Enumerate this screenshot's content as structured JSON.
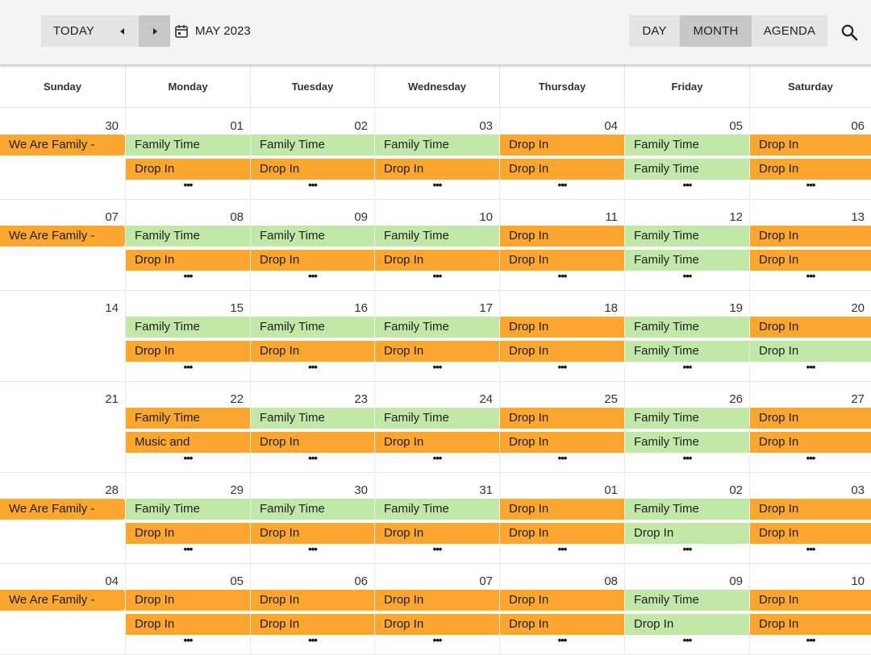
{
  "toolbar": {
    "today_label": "TODAY",
    "prev_icon": "triangle-left",
    "next_icon": "triangle-right",
    "calendar_icon": "calendar-icon",
    "date_range": "MAY 2023",
    "views": [
      {
        "label": "DAY",
        "active": false
      },
      {
        "label": "MONTH",
        "active": true
      },
      {
        "label": "AGENDA",
        "active": false
      }
    ],
    "search_icon": "search-icon"
  },
  "day_names": [
    "Sunday",
    "Monday",
    "Tuesday",
    "Wednesday",
    "Thursday",
    "Friday",
    "Saturday"
  ],
  "colors": {
    "orange": "#fba62f",
    "green": "#c2e8a8"
  },
  "weeks": [
    {
      "days": [
        {
          "date": "30",
          "events": [
            {
              "title": "We Are Family -",
              "color": "orange"
            }
          ]
        },
        {
          "date": "01",
          "events": [
            {
              "title": "Family Time",
              "color": "green"
            },
            {
              "title": "Drop In",
              "color": "orange"
            }
          ],
          "more": "•••"
        },
        {
          "date": "02",
          "events": [
            {
              "title": "Family Time",
              "color": "green"
            },
            {
              "title": "Drop In",
              "color": "orange"
            }
          ],
          "more": "•••"
        },
        {
          "date": "03",
          "events": [
            {
              "title": "Family Time",
              "color": "green"
            },
            {
              "title": "Drop In",
              "color": "orange"
            }
          ],
          "more": "•••"
        },
        {
          "date": "04",
          "events": [
            {
              "title": "Drop In",
              "color": "orange"
            },
            {
              "title": "Drop In",
              "color": "orange"
            }
          ],
          "more": "•••"
        },
        {
          "date": "05",
          "events": [
            {
              "title": "Family Time",
              "color": "green"
            },
            {
              "title": "Family Time",
              "color": "green"
            }
          ],
          "more": "•••"
        },
        {
          "date": "06",
          "events": [
            {
              "title": "Drop In",
              "color": "orange"
            },
            {
              "title": "Drop In",
              "color": "orange"
            }
          ],
          "more": "•••"
        }
      ]
    },
    {
      "days": [
        {
          "date": "07",
          "events": [
            {
              "title": "We Are Family -",
              "color": "orange"
            }
          ]
        },
        {
          "date": "08",
          "events": [
            {
              "title": "Family Time",
              "color": "green"
            },
            {
              "title": "Drop In",
              "color": "orange"
            }
          ],
          "more": "•••"
        },
        {
          "date": "09",
          "events": [
            {
              "title": "Family Time",
              "color": "green"
            },
            {
              "title": "Drop In",
              "color": "orange"
            }
          ],
          "more": "•••"
        },
        {
          "date": "10",
          "events": [
            {
              "title": "Family Time",
              "color": "green"
            },
            {
              "title": "Drop In",
              "color": "orange"
            }
          ],
          "more": "•••"
        },
        {
          "date": "11",
          "events": [
            {
              "title": "Drop In",
              "color": "orange"
            },
            {
              "title": "Drop In",
              "color": "orange"
            }
          ],
          "more": "•••"
        },
        {
          "date": "12",
          "events": [
            {
              "title": "Family Time",
              "color": "green"
            },
            {
              "title": "Family Time",
              "color": "green"
            }
          ],
          "more": "•••"
        },
        {
          "date": "13",
          "events": [
            {
              "title": "Drop In",
              "color": "orange"
            },
            {
              "title": "Drop In",
              "color": "orange"
            }
          ],
          "more": "•••"
        }
      ]
    },
    {
      "days": [
        {
          "date": "14",
          "events": []
        },
        {
          "date": "15",
          "events": [
            {
              "title": "Family Time",
              "color": "green"
            },
            {
              "title": "Drop In",
              "color": "orange"
            }
          ],
          "more": "•••"
        },
        {
          "date": "16",
          "events": [
            {
              "title": "Family Time",
              "color": "green"
            },
            {
              "title": "Drop In",
              "color": "orange"
            }
          ],
          "more": "•••"
        },
        {
          "date": "17",
          "events": [
            {
              "title": "Family Time",
              "color": "green"
            },
            {
              "title": "Drop In",
              "color": "orange"
            }
          ],
          "more": "•••"
        },
        {
          "date": "18",
          "events": [
            {
              "title": "Drop In",
              "color": "orange"
            },
            {
              "title": "Drop In",
              "color": "orange"
            }
          ],
          "more": "•••"
        },
        {
          "date": "19",
          "events": [
            {
              "title": "Family Time",
              "color": "green"
            },
            {
              "title": "Family Time",
              "color": "green"
            }
          ],
          "more": "•••"
        },
        {
          "date": "20",
          "events": [
            {
              "title": "Drop In",
              "color": "orange"
            },
            {
              "title": "Drop In",
              "color": "green"
            }
          ],
          "more": "•••"
        }
      ]
    },
    {
      "days": [
        {
          "date": "21",
          "events": []
        },
        {
          "date": "22",
          "events": [
            {
              "title": "Family Time",
              "color": "orange"
            },
            {
              "title": "Music and",
              "color": "orange"
            }
          ],
          "more": "•••"
        },
        {
          "date": "23",
          "events": [
            {
              "title": "Family Time",
              "color": "green"
            },
            {
              "title": "Drop In",
              "color": "orange"
            }
          ],
          "more": "•••"
        },
        {
          "date": "24",
          "events": [
            {
              "title": "Family Time",
              "color": "green"
            },
            {
              "title": "Drop In",
              "color": "orange"
            }
          ],
          "more": "•••"
        },
        {
          "date": "25",
          "events": [
            {
              "title": "Drop In",
              "color": "orange"
            },
            {
              "title": "Drop In",
              "color": "orange"
            }
          ],
          "more": "•••"
        },
        {
          "date": "26",
          "events": [
            {
              "title": "Family Time",
              "color": "green"
            },
            {
              "title": "Family Time",
              "color": "green"
            }
          ],
          "more": "•••"
        },
        {
          "date": "27",
          "events": [
            {
              "title": "Drop In",
              "color": "orange"
            },
            {
              "title": "Drop In",
              "color": "orange"
            }
          ],
          "more": "•••"
        }
      ]
    },
    {
      "days": [
        {
          "date": "28",
          "events": [
            {
              "title": "We Are Family -",
              "color": "orange"
            }
          ]
        },
        {
          "date": "29",
          "events": [
            {
              "title": "Family Time",
              "color": "green"
            },
            {
              "title": "Drop In",
              "color": "orange"
            }
          ],
          "more": "•••"
        },
        {
          "date": "30",
          "events": [
            {
              "title": "Family Time",
              "color": "green"
            },
            {
              "title": "Drop In",
              "color": "orange"
            }
          ],
          "more": "•••"
        },
        {
          "date": "31",
          "events": [
            {
              "title": "Family Time",
              "color": "green"
            },
            {
              "title": "Drop In",
              "color": "orange"
            }
          ],
          "more": "•••"
        },
        {
          "date": "01",
          "events": [
            {
              "title": "Drop In",
              "color": "orange"
            },
            {
              "title": "Drop In",
              "color": "orange"
            }
          ],
          "more": "•••"
        },
        {
          "date": "02",
          "events": [
            {
              "title": "Family Time",
              "color": "green"
            },
            {
              "title": "Drop In",
              "color": "green"
            }
          ],
          "more": "•••"
        },
        {
          "date": "03",
          "events": [
            {
              "title": "Drop In",
              "color": "orange"
            },
            {
              "title": "Drop In",
              "color": "orange"
            }
          ],
          "more": "•••"
        }
      ]
    },
    {
      "days": [
        {
          "date": "04",
          "events": [
            {
              "title": "We Are Family -",
              "color": "orange"
            }
          ]
        },
        {
          "date": "05",
          "events": [
            {
              "title": "Drop In",
              "color": "orange"
            },
            {
              "title": "Drop In",
              "color": "orange"
            }
          ],
          "more": "•••"
        },
        {
          "date": "06",
          "events": [
            {
              "title": "Drop In",
              "color": "orange"
            },
            {
              "title": "Drop In",
              "color": "orange"
            }
          ],
          "more": "•••"
        },
        {
          "date": "07",
          "events": [
            {
              "title": "Drop In",
              "color": "orange"
            },
            {
              "title": "Drop In",
              "color": "orange"
            }
          ],
          "more": "•••"
        },
        {
          "date": "08",
          "events": [
            {
              "title": "Drop In",
              "color": "orange"
            },
            {
              "title": "Drop In",
              "color": "orange"
            }
          ],
          "more": "•••"
        },
        {
          "date": "09",
          "events": [
            {
              "title": "Family Time",
              "color": "green"
            },
            {
              "title": "Drop In",
              "color": "green"
            }
          ],
          "more": "•••"
        },
        {
          "date": "10",
          "events": [
            {
              "title": "Drop In",
              "color": "orange"
            },
            {
              "title": "Drop In",
              "color": "orange"
            }
          ],
          "more": "•••"
        }
      ]
    }
  ]
}
